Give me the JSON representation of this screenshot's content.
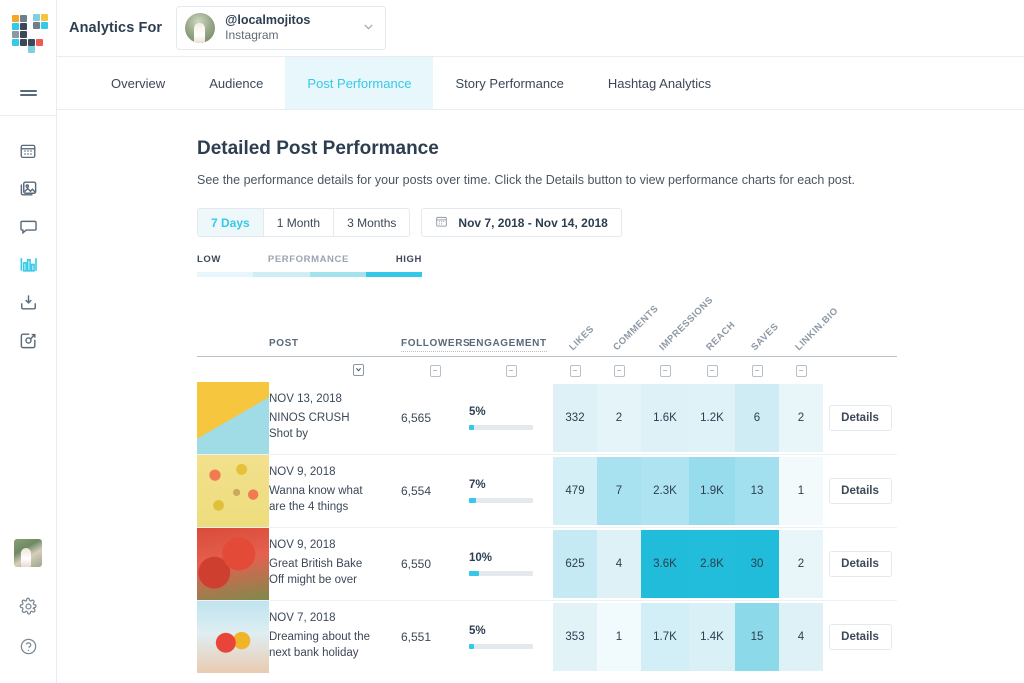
{
  "brand": {
    "accent": "#35c9e8",
    "logo_name": "later-logo"
  },
  "sidebar": {
    "items": [
      {
        "name": "calendar",
        "label": "Calendar"
      },
      {
        "name": "media",
        "label": "Media Library"
      },
      {
        "name": "conversations",
        "label": "Conversations"
      },
      {
        "name": "analytics",
        "label": "Analytics",
        "active": true
      },
      {
        "name": "collect",
        "label": "Collect Media"
      },
      {
        "name": "linkinbio",
        "label": "Linkin.bio"
      }
    ],
    "bottom": [
      {
        "name": "user-avatar",
        "label": "Account"
      },
      {
        "name": "settings",
        "label": "Settings"
      },
      {
        "name": "help",
        "label": "Help"
      }
    ]
  },
  "topbar": {
    "title": "Analytics For",
    "account": {
      "handle": "@localmojitos",
      "platform": "Instagram"
    }
  },
  "tabs": [
    {
      "label": "Overview",
      "active": false
    },
    {
      "label": "Audience",
      "active": false
    },
    {
      "label": "Post Performance",
      "active": true
    },
    {
      "label": "Story Performance",
      "active": false
    },
    {
      "label": "Hashtag Analytics",
      "active": false
    }
  ],
  "page": {
    "title": "Detailed Post Performance",
    "description": "See the performance details for your posts over time. Click the Details button to view performance charts for each post."
  },
  "controls": {
    "ranges": [
      {
        "label": "7 Days",
        "active": true
      },
      {
        "label": "1 Month",
        "active": false
      },
      {
        "label": "3 Months",
        "active": false
      }
    ],
    "date_range": "Nov 7, 2018 - Nov 14, 2018",
    "calendar_icon": "calendar-icon"
  },
  "legend": {
    "low": "LOW",
    "mid": "PERFORMANCE",
    "high": "HIGH",
    "colors": [
      "#e7f6fa",
      "#cdeef5",
      "#a5e2ef",
      "#35c9e8"
    ]
  },
  "table": {
    "columns": {
      "post": "POST",
      "followers": "FOLLOWERS",
      "engagement": "ENGAGEMENT",
      "metrics": [
        "LIKES",
        "COMMENTS",
        "IMPRESSIONS",
        "REACH",
        "SAVES",
        "LINKIN.BIO"
      ]
    },
    "details_label": "Details",
    "rows": [
      {
        "date": "NOV 13, 2018",
        "caption_line1": "NINOS CRUSH",
        "caption_line2": "Shot by",
        "followers": "6,565",
        "engagement_pct": "5%",
        "engagement_fill": 8,
        "metrics": [
          {
            "value": "332",
            "shade": "#ddf1f7"
          },
          {
            "value": "2",
            "shade": "#e5f4f9"
          },
          {
            "value": "1.6K",
            "shade": "#ddf1f7"
          },
          {
            "value": "1.2K",
            "shade": "#dff2f8"
          },
          {
            "value": "6",
            "shade": "#cfecf5"
          },
          {
            "value": "2",
            "shade": "#e8f6fa"
          }
        ]
      },
      {
        "date": "NOV 9, 2018",
        "caption_line1": "Wanna know what",
        "caption_line2": "are the 4 things",
        "followers": "6,554",
        "engagement_pct": "7%",
        "engagement_fill": 11,
        "metrics": [
          {
            "value": "479",
            "shade": "#d4eff6"
          },
          {
            "value": "7",
            "shade": "#a8e2f0"
          },
          {
            "value": "2.3K",
            "shade": "#aee4f1"
          },
          {
            "value": "1.9K",
            "shade": "#97dced"
          },
          {
            "value": "13",
            "shade": "#a3e0ef"
          },
          {
            "value": "1",
            "shade": "#f2fafc"
          }
        ]
      },
      {
        "date": "NOV 9, 2018",
        "caption_line1": "Great British Bake",
        "caption_line2": "Off might be over",
        "followers": "6,550",
        "engagement_pct": "10%",
        "engagement_fill": 15,
        "metrics": [
          {
            "value": "625",
            "shade": "#c6eaf4"
          },
          {
            "value": "4",
            "shade": "#ddf1f7"
          },
          {
            "value": "3.6K",
            "shade": "#21bcd9"
          },
          {
            "value": "2.8K",
            "shade": "#22bdda"
          },
          {
            "value": "30",
            "shade": "#20bcd9"
          },
          {
            "value": "2",
            "shade": "#e8f6fa"
          }
        ]
      },
      {
        "date": "NOV 7, 2018",
        "caption_line1": "Dreaming about the",
        "caption_line2": "next bank holiday",
        "followers": "6,551",
        "engagement_pct": "5%",
        "engagement_fill": 8,
        "metrics": [
          {
            "value": "353",
            "shade": "#e2f3f8"
          },
          {
            "value": "1",
            "shade": "#f1fafc"
          },
          {
            "value": "1.7K",
            "shade": "#d2eef6"
          },
          {
            "value": "1.4K",
            "shade": "#daf0f7"
          },
          {
            "value": "15",
            "shade": "#8cd9ea"
          },
          {
            "value": "4",
            "shade": "#ddf1f7"
          }
        ]
      }
    ]
  }
}
